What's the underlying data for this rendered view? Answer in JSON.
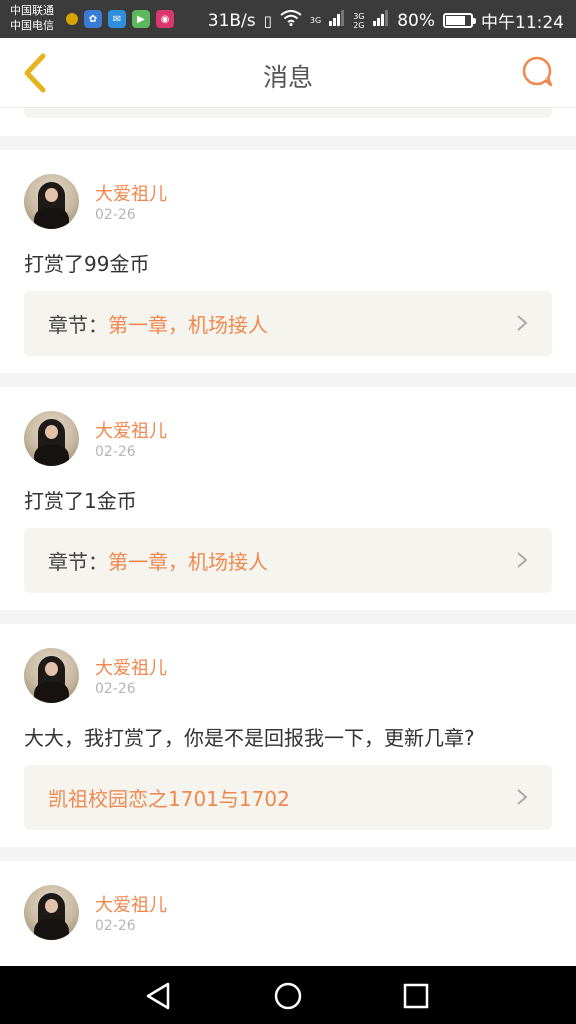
{
  "status_bar": {
    "carrier_1": "中国联通",
    "carrier_2": "中国电信",
    "speed": "31B/s",
    "signal_3g": "3G",
    "signal_3g_2g": "3G 2G",
    "battery_text": "80%",
    "battery_level": 0.8,
    "time": "中午11:24"
  },
  "navbar": {
    "back_icon": "chevron-left-icon",
    "title": "消息",
    "chat_icon": "speech-bubble-icon"
  },
  "colors": {
    "accent": "#f0884e",
    "back_icon": "#e8b21f",
    "link_bg": "#f5f4ee"
  },
  "messages": [
    {
      "username": "大爱祖儿",
      "date": "02-26",
      "text": "打赏了99金币",
      "link_label": "章节：",
      "link_value": "第一章，机场接人"
    },
    {
      "username": "大爱祖儿",
      "date": "02-26",
      "text": "打赏了1金币",
      "link_label": "章节：",
      "link_value": "第一章，机场接人"
    },
    {
      "username": "大爱祖儿",
      "date": "02-26",
      "text": "大大，我打赏了，你是不是回报我一下，更新几章?",
      "link_label": "",
      "link_value": "凯祖校园恋之1701与1702"
    },
    {
      "username": "大爱祖儿",
      "date": "02-26"
    }
  ],
  "system_nav": {
    "back": "triangle-back-icon",
    "home": "circle-home-icon",
    "recents": "square-recents-icon"
  }
}
